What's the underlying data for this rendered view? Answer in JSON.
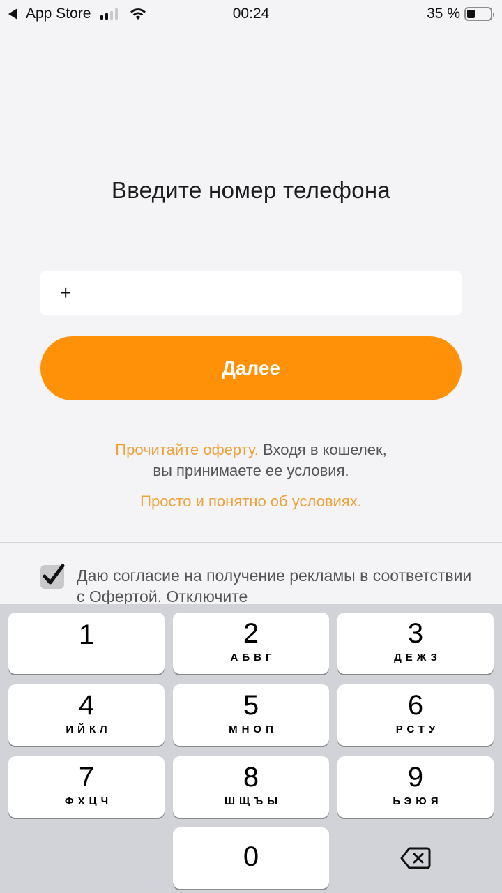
{
  "status_bar": {
    "back_app": "App Store",
    "time": "00:24",
    "battery_percent_text": "35 %",
    "battery_level": 0.35,
    "signal_bars_active": 2,
    "signal_bars_total": 4
  },
  "title": "Введите номер телефона",
  "phone_input": {
    "value": "+"
  },
  "next_button": {
    "label": "Далее",
    "color": "#ff9108"
  },
  "offer": {
    "link_label": "Прочитайте оферту.",
    "text_line1": " Входя в кошелек,",
    "text_line2": "вы принимаете ее условия.",
    "simple_link": "Просто и понятно об условиях."
  },
  "consent": {
    "checked": true,
    "text": "Даю согласие на получение рекламы в соответствии с Офертой. Отключите"
  },
  "keypad": {
    "keys": [
      {
        "num": "1",
        "letters": ""
      },
      {
        "num": "2",
        "letters": "АБВГ"
      },
      {
        "num": "3",
        "letters": "ДЕЖЗ"
      },
      {
        "num": "4",
        "letters": "ИЙКЛ"
      },
      {
        "num": "5",
        "letters": "МНОП"
      },
      {
        "num": "6",
        "letters": "РСТУ"
      },
      {
        "num": "7",
        "letters": "ФХЦЧ"
      },
      {
        "num": "8",
        "letters": "ШЩЪЫ"
      },
      {
        "num": "9",
        "letters": "ЬЭЮЯ"
      },
      {
        "num": "0",
        "letters": ""
      }
    ],
    "backspace_icon": "backspace-icon"
  },
  "colors": {
    "accent": "#ff9108",
    "link": "#eea33a",
    "background": "#f4f3f6",
    "keypad_bg": "#d1d3d9"
  }
}
